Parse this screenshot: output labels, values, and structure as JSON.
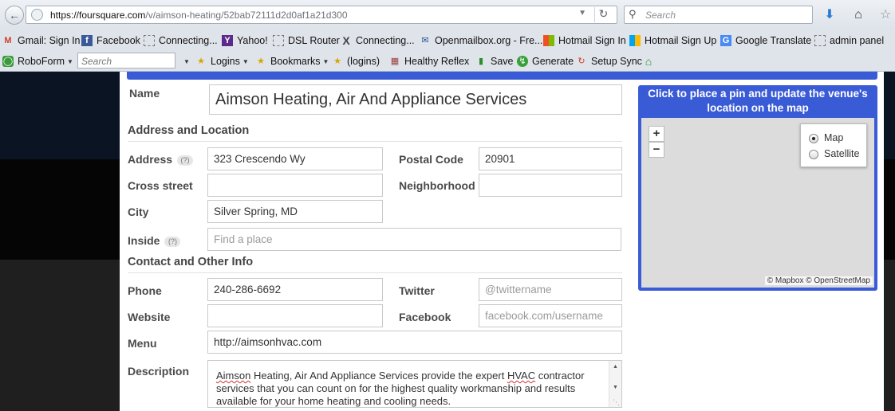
{
  "browser": {
    "url_host": "https://foursquare.com",
    "url_path": "/v/aimson-heating/52bab72111d2d0af1a21d300",
    "search_placeholder": "Search",
    "bookmarks": [
      {
        "label": "Gmail: Sign In",
        "icon": "gmail-icon"
      },
      {
        "label": "Facebook",
        "icon": "facebook-icon"
      },
      {
        "label": "Connecting...",
        "icon": "blank-page-icon"
      },
      {
        "label": "Yahoo!",
        "icon": "yahoo-icon"
      },
      {
        "label": "DSL Router",
        "icon": "blank-page-icon"
      },
      {
        "label": "Connecting...",
        "icon": "x-icon"
      },
      {
        "label": "Openmailbox.org - Fre...",
        "icon": "mailbox-icon"
      },
      {
        "label": "Hotmail Sign In",
        "icon": "windows-icon"
      },
      {
        "label": "Hotmail Sign Up",
        "icon": "windows-icon"
      },
      {
        "label": "Google Translate",
        "icon": "translate-icon"
      },
      {
        "label": "admin panel",
        "icon": "blank-page-icon"
      }
    ],
    "roboform": {
      "brand": "RoboForm",
      "search_placeholder": "Search",
      "logins": "Logins",
      "bookmarks": "Bookmarks",
      "logins_paren": "(logins)",
      "healthy_reflex": "Healthy Reflex",
      "save": "Save",
      "generate": "Generate",
      "setup_sync": "Setup Sync"
    }
  },
  "form": {
    "name_label": "Name",
    "name_value": "Aimson Heating, Air And Appliance Services",
    "address_section": "Address and Location",
    "address_label": "Address",
    "help_mark": "(?)",
    "address_value": "323 Crescendo Wy",
    "postal_label": "Postal Code",
    "postal_value": "20901",
    "cross_label": "Cross street",
    "neighborhood_label": "Neighborhood",
    "city_label": "City",
    "city_value": "Silver Spring, MD",
    "inside_label": "Inside",
    "inside_placeholder": "Find a place",
    "contact_section": "Contact and Other Info",
    "phone_label": "Phone",
    "phone_value": "240-286-6692",
    "twitter_label": "Twitter",
    "twitter_placeholder": "@twittername",
    "website_label": "Website",
    "facebook_label": "Facebook",
    "facebook_placeholder": "facebook.com/username",
    "menu_label": "Menu",
    "menu_value": "http://aimsonhvac.com",
    "description_label": "Description",
    "description_word1": "Aimson",
    "description_mid": " Heating, Air And Appliance Services provide the expert ",
    "description_word2": "HVAC",
    "description_rest": " contractor services that you can count on for the highest quality workmanship and results available for your home heating and cooling needs."
  },
  "map": {
    "header": "Click to place a pin and update the venue's location on the map",
    "zoom_in": "+",
    "zoom_out": "−",
    "layer_map": "Map",
    "layer_satellite": "Satellite",
    "attribution": "© Mapbox © OpenStreetMap",
    "accent_color": "#3a5bd6"
  }
}
